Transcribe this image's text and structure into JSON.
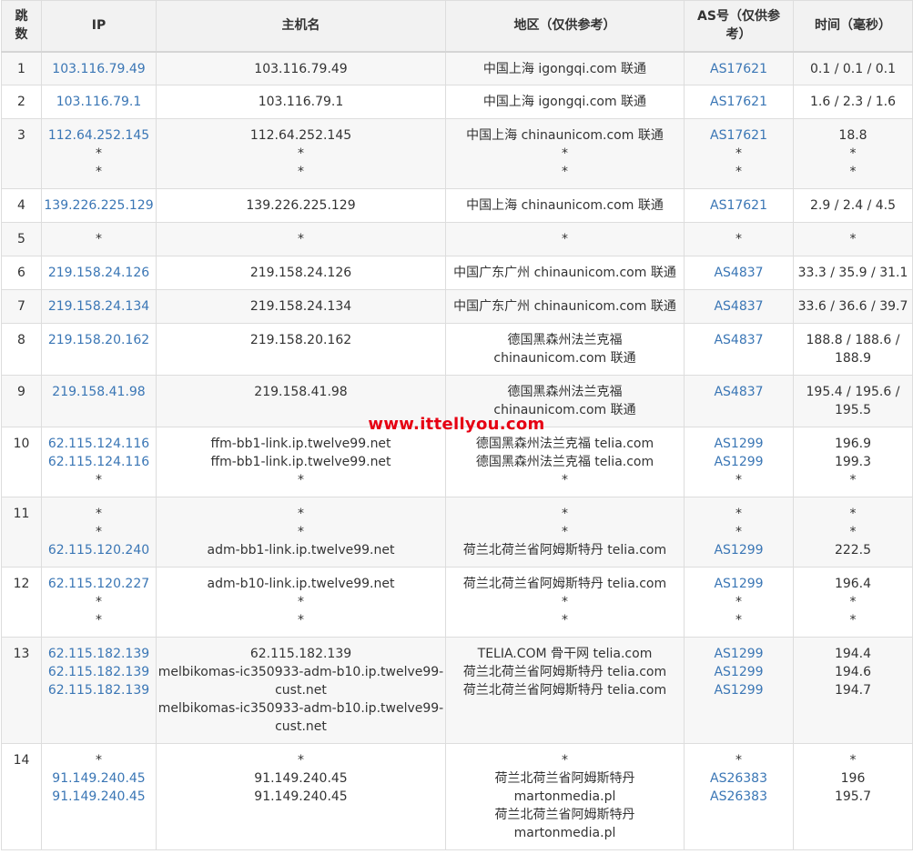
{
  "headers": {
    "hop": "跳数",
    "ip": "IP",
    "hostname": "主机名",
    "region": "地区（仅供参考）",
    "as": "AS号（仅供参考）",
    "time": "时间（毫秒）"
  },
  "watermark": "www.ittellyou.com",
  "rows": [
    {
      "hop": "1",
      "ip": [
        "103.116.79.49"
      ],
      "host": [
        "103.116.79.49"
      ],
      "region": [
        "中国上海 igongqi.com 联通"
      ],
      "as": [
        "AS17621"
      ],
      "time": [
        "0.1 / 0.1 / 0.1"
      ]
    },
    {
      "hop": "2",
      "ip": [
        "103.116.79.1"
      ],
      "host": [
        "103.116.79.1"
      ],
      "region": [
        "中国上海 igongqi.com 联通"
      ],
      "as": [
        "AS17621"
      ],
      "time": [
        "1.6 / 2.3 / 1.6"
      ]
    },
    {
      "hop": "3",
      "ip": [
        "112.64.252.145",
        "*",
        "*"
      ],
      "host": [
        "112.64.252.145",
        "*",
        "*"
      ],
      "region": [
        "中国上海 chinaunicom.com 联通",
        "*",
        "*"
      ],
      "as": [
        "AS17621",
        "*",
        "*"
      ],
      "time": [
        "18.8",
        "*",
        "*"
      ]
    },
    {
      "hop": "4",
      "ip": [
        "139.226.225.129"
      ],
      "host": [
        "139.226.225.129"
      ],
      "region": [
        "中国上海 chinaunicom.com 联通"
      ],
      "as": [
        "AS17621"
      ],
      "time": [
        "2.9 / 2.4 / 4.5"
      ]
    },
    {
      "hop": "5",
      "ip": [
        "*"
      ],
      "host": [
        "*"
      ],
      "region": [
        "*"
      ],
      "as": [
        "*"
      ],
      "time": [
        "*"
      ]
    },
    {
      "hop": "6",
      "ip": [
        "219.158.24.126"
      ],
      "host": [
        "219.158.24.126"
      ],
      "region": [
        "中国广东广州 chinaunicom.com 联通"
      ],
      "as": [
        "AS4837"
      ],
      "time": [
        "33.3 / 35.9 / 31.1"
      ]
    },
    {
      "hop": "7",
      "ip": [
        "219.158.24.134"
      ],
      "host": [
        "219.158.24.134"
      ],
      "region": [
        "中国广东广州 chinaunicom.com 联通"
      ],
      "as": [
        "AS4837"
      ],
      "time": [
        "33.6 / 36.6 / 39.7"
      ]
    },
    {
      "hop": "8",
      "ip": [
        "219.158.20.162"
      ],
      "host": [
        "219.158.20.162"
      ],
      "region": [
        "德国黑森州法兰克福",
        "chinaunicom.com 联通"
      ],
      "as": [
        "AS4837"
      ],
      "time": [
        "188.8 / 188.6 /",
        "188.9"
      ]
    },
    {
      "hop": "9",
      "ip": [
        "219.158.41.98"
      ],
      "host": [
        "219.158.41.98"
      ],
      "region": [
        "德国黑森州法兰克福",
        "chinaunicom.com 联通"
      ],
      "as": [
        "AS4837"
      ],
      "time": [
        "195.4 / 195.6 /",
        "195.5"
      ]
    },
    {
      "hop": "10",
      "ip": [
        "62.115.124.116",
        "62.115.124.116",
        "*"
      ],
      "host": [
        "ffm-bb1-link.ip.twelve99.net",
        "ffm-bb1-link.ip.twelve99.net",
        "*"
      ],
      "region": [
        "德国黑森州法兰克福 telia.com",
        "德国黑森州法兰克福 telia.com",
        "*"
      ],
      "as": [
        "AS1299",
        "AS1299",
        "*"
      ],
      "time": [
        "196.9",
        "199.3",
        "*"
      ]
    },
    {
      "hop": "11",
      "ip": [
        "*",
        "*",
        "62.115.120.240"
      ],
      "host": [
        "*",
        "*",
        "adm-bb1-link.ip.twelve99.net"
      ],
      "region": [
        "*",
        "*",
        "荷兰北荷兰省阿姆斯特丹 telia.com"
      ],
      "as": [
        "*",
        "*",
        "AS1299"
      ],
      "time": [
        "*",
        "*",
        "222.5"
      ]
    },
    {
      "hop": "12",
      "ip": [
        "62.115.120.227",
        "*",
        "*"
      ],
      "host": [
        "adm-b10-link.ip.twelve99.net",
        "*",
        "*"
      ],
      "region": [
        "荷兰北荷兰省阿姆斯特丹 telia.com",
        "*",
        "*"
      ],
      "as": [
        "AS1299",
        "*",
        "*"
      ],
      "time": [
        "196.4",
        "*",
        "*"
      ]
    },
    {
      "hop": "13",
      "ip": [
        "62.115.182.139",
        "62.115.182.139",
        "62.115.182.139"
      ],
      "host": [
        "62.115.182.139",
        "melbikomas-ic350933-adm-b10.ip.twelve99-",
        "cust.net",
        "melbikomas-ic350933-adm-b10.ip.twelve99-",
        "cust.net"
      ],
      "region": [
        "TELIA.COM 骨干网 telia.com",
        "荷兰北荷兰省阿姆斯特丹 telia.com",
        "荷兰北荷兰省阿姆斯特丹 telia.com"
      ],
      "as": [
        "AS1299",
        "AS1299",
        "AS1299"
      ],
      "time": [
        "194.4",
        "194.6",
        "194.7"
      ]
    },
    {
      "hop": "14",
      "ip": [
        "*",
        "91.149.240.45",
        "91.149.240.45"
      ],
      "host": [
        "*",
        "91.149.240.45",
        "91.149.240.45"
      ],
      "region": [
        "*",
        "荷兰北荷兰省阿姆斯特丹",
        "martonmedia.pl",
        "荷兰北荷兰省阿姆斯特丹",
        "martonmedia.pl"
      ],
      "as": [
        "*",
        "AS26383",
        "AS26383"
      ],
      "time": [
        "*",
        "196",
        "195.7"
      ]
    }
  ]
}
